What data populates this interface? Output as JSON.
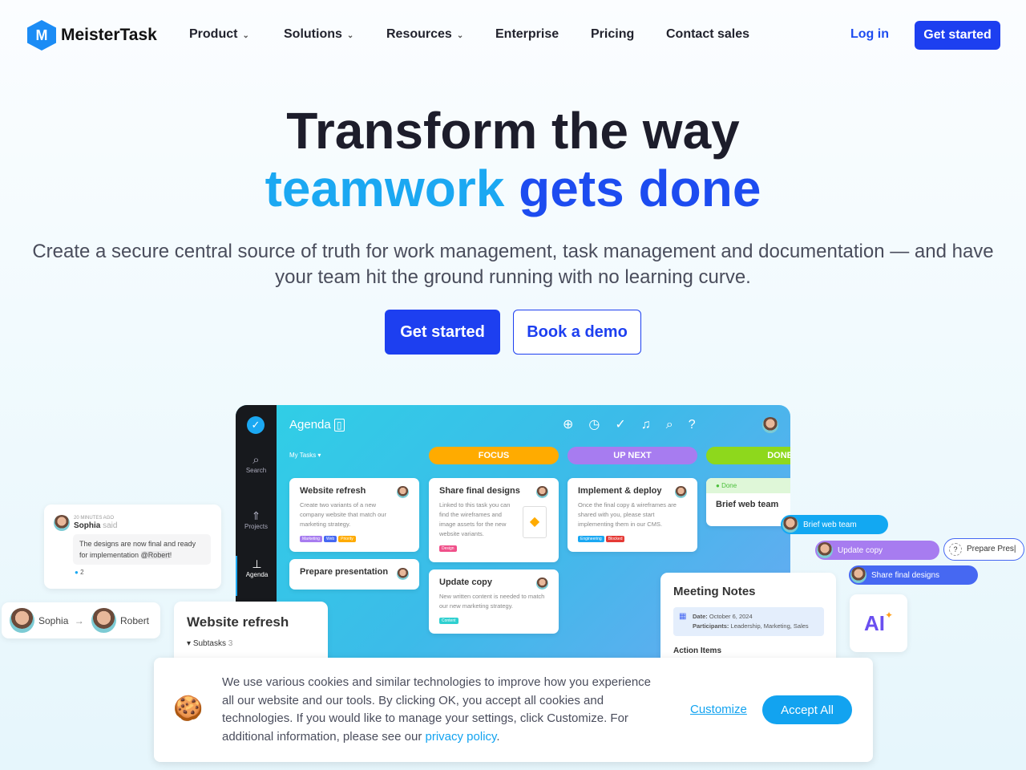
{
  "nav": {
    "brand": "MeisterTask",
    "items": [
      "Product",
      "Solutions",
      "Resources",
      "Enterprise",
      "Pricing",
      "Contact sales"
    ],
    "login": "Log in",
    "get_started": "Get started"
  },
  "hero": {
    "line1": "Transform the way",
    "line2a": "teamwork",
    "line2b": "gets done",
    "subtitle": "Create a secure central source of truth for work management, task management and documentation — and have your team hit the ground running with no learning curve.",
    "primary": "Get started",
    "secondary": "Book a demo"
  },
  "app": {
    "title": "Agenda",
    "filter": "My Tasks",
    "sidebar": [
      "Search",
      "Projects",
      "Agenda"
    ],
    "columns": [
      {
        "label": "FOCUS",
        "color": "#ffab00"
      },
      {
        "label": "UP NEXT",
        "color": "#a77cf0"
      },
      {
        "label": "DONE",
        "color": "#8ed81c"
      }
    ],
    "cards": {
      "website": {
        "title": "Website refresh",
        "desc": "Create two variants of a new company website that match our marketing strategy.",
        "tags": [
          "Marketing",
          "Web",
          "Priority"
        ]
      },
      "prepare": {
        "title": "Prepare presentation"
      },
      "share": {
        "title": "Share final designs",
        "desc": "Linked to this task you can find the wireframes and image assets for the new website variants.",
        "tags": [
          "Design"
        ]
      },
      "update": {
        "title": "Update copy",
        "desc": "New written content is needed to match our new marketing strategy.",
        "tags": [
          "Content"
        ]
      },
      "implement": {
        "title": "Implement & deploy",
        "desc": "Once the final copy & wireframes are shared with you, please start implementing them in our CMS.",
        "tags": [
          "Engineering",
          "Blocked"
        ]
      },
      "brief": {
        "status": "Done",
        "title": "Brief web team"
      }
    }
  },
  "comment": {
    "time": "20 MINUTES AGO",
    "author": "Sophia",
    "said": "said",
    "text": "The designs are now final and ready for implementation",
    "mention": "@Robert",
    "suffix": "!",
    "likes": "2"
  },
  "handoff": {
    "from": "Sophia",
    "arrow": "→",
    "to": "Robert"
  },
  "detail": {
    "title": "Website refresh",
    "subtasks": "Subtasks",
    "count": "3"
  },
  "pills": [
    "Brief web team",
    "Update copy",
    "Share final designs"
  ],
  "input": {
    "value": "Prepare Pres"
  },
  "meeting": {
    "title": "Meeting Notes",
    "date_label": "Date:",
    "date": "October 6, 2024",
    "participants_label": "Participants:",
    "participants": "Leadership, Marketing, Sales",
    "action": "Action Items"
  },
  "ai": {
    "label": "AI"
  },
  "cookie": {
    "text": "We use various cookies and similar technologies to improve how you experience all our website and our tools. By clicking OK, you accept all cookies and technologies. If you would like to manage your settings, click Customize. For additional information, please see our ",
    "link": "privacy policy",
    "end": ".",
    "customize": "Customize",
    "accept": "Accept All"
  }
}
